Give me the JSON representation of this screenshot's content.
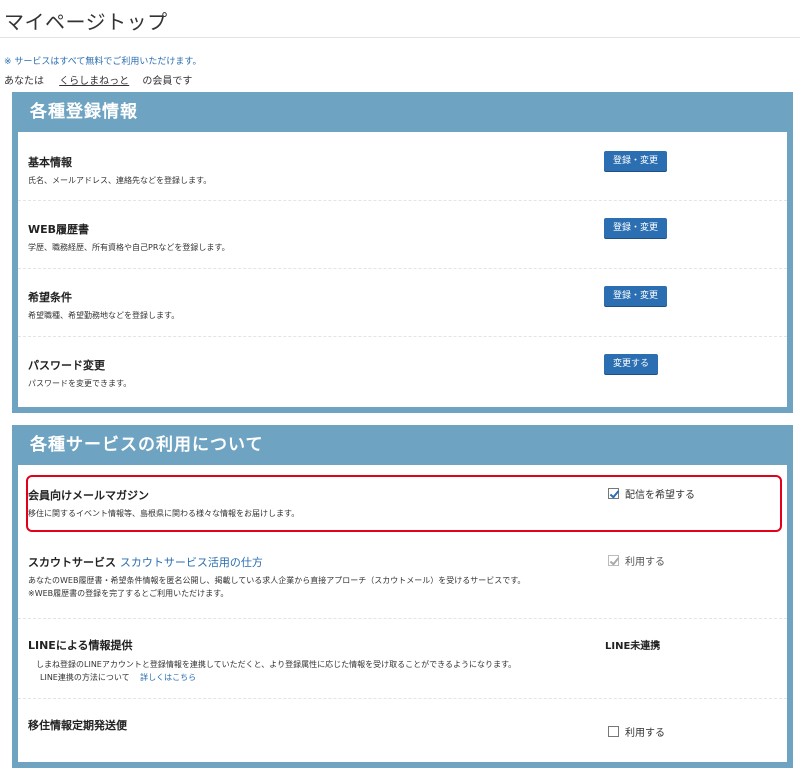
{
  "page": {
    "title": "マイページトップ",
    "notice": "※ サービスはすべて無料でご利用いただけます。",
    "member_prefix": "あなたは",
    "member_site": "くらしまねっと",
    "member_suffix": "の会員です"
  },
  "registration": {
    "heading": "各種登録情報",
    "items": [
      {
        "title": "基本情報",
        "desc": "氏名、メールアドレス、連絡先などを登録します。",
        "button": "登録・変更"
      },
      {
        "title": "WEB履歴書",
        "desc": "学歴、職務経歴、所有資格や自己PRなどを登録します。",
        "button": "登録・変更"
      },
      {
        "title": "希望条件",
        "desc": "希望職種、希望勤務地などを登録します。",
        "button": "登録・変更"
      },
      {
        "title": "パスワード変更",
        "desc": "パスワードを変更できます。",
        "button": "変更する"
      }
    ]
  },
  "services": {
    "heading": "各種サービスの利用について",
    "mail": {
      "title": "会員向けメールマガジン",
      "desc": "移住に関するイベント情報等、島根県に関わる様々な情報をお届けします。",
      "checkbox_label": "配信を希望する",
      "checked": true
    },
    "scout": {
      "title": "スカウトサービス",
      "link": "スカウトサービス活用の仕方",
      "desc1": "あなたのWEB履歴書・希望条件情報を匿名公開し、掲載している求人企業から直接アプローチ（スカウトメール）を受けるサービスです。",
      "desc2": "※WEB履歴書の登録を完了するとご利用いただけます。",
      "checkbox_label": "利用する",
      "checked": true,
      "disabled": true
    },
    "line": {
      "title": "LINEによる情報提供",
      "desc1": "しまね登録のLINEアカウントと登録情報を連携していただくと、より登録属性に応じた情報を受け取ることができるようになります。",
      "desc2_prefix": "LINE連携の方法について",
      "desc2_link": "詳しくはこちら",
      "status": "LINE未連携"
    },
    "delivery": {
      "title": "移住情報定期発送便",
      "checkbox_label": "利用する",
      "checked": false
    }
  }
}
